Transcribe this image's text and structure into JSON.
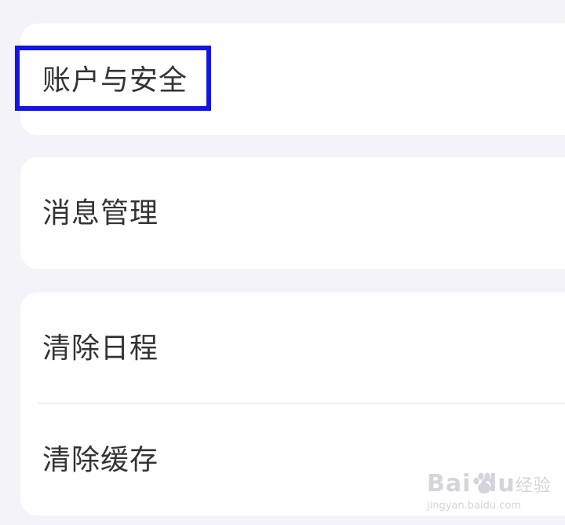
{
  "settings": {
    "groups": [
      {
        "items": [
          {
            "label": "账户与安全"
          }
        ]
      },
      {
        "items": [
          {
            "label": "消息管理"
          }
        ]
      },
      {
        "items": [
          {
            "label": "清除日程"
          },
          {
            "label": "清除缓存"
          }
        ]
      }
    ]
  },
  "watermark": {
    "brand": "Bai  du",
    "brand_suffix": "经验",
    "url": "jingyan.baidu.com"
  },
  "highlight_color": "#1414e6"
}
